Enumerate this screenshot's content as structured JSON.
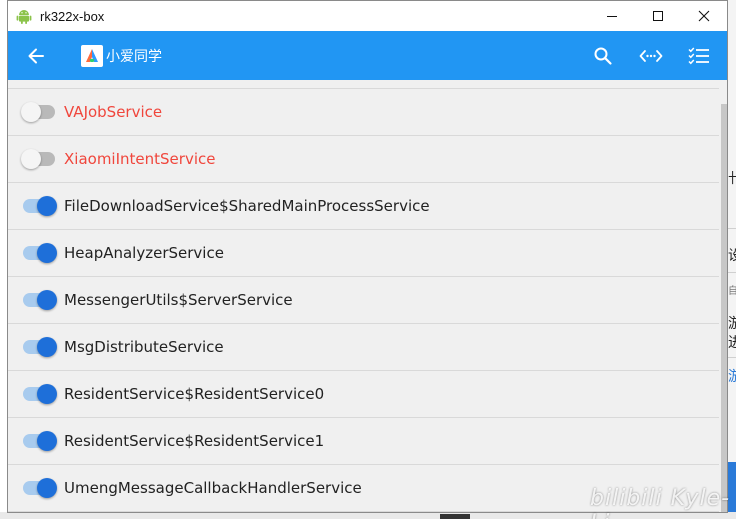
{
  "window": {
    "title": "rk322x-box",
    "controls": [
      {
        "name": "minimize-button",
        "icon": "minimize-icon"
      },
      {
        "name": "maximize-button",
        "icon": "maximize-icon"
      },
      {
        "name": "close-button",
        "icon": "close-icon"
      }
    ]
  },
  "appbar": {
    "back_icon": "arrow-left-icon",
    "app_name": "小爱同学",
    "actions": [
      {
        "name": "search-button",
        "icon": "search-icon"
      },
      {
        "name": "code-button",
        "icon": "code-icon"
      },
      {
        "name": "checklist-button",
        "icon": "checklist-icon"
      }
    ],
    "color": "#2196f3"
  },
  "services": [
    {
      "name": "VAJobService",
      "enabled": false
    },
    {
      "name": "XiaomiIntentService",
      "enabled": false
    },
    {
      "name": "FileDownloadService$SharedMainProcessService",
      "enabled": true
    },
    {
      "name": "HeapAnalyzerService",
      "enabled": true
    },
    {
      "name": "MessengerUtils$ServerService",
      "enabled": true
    },
    {
      "name": "MsgDistributeService",
      "enabled": true
    },
    {
      "name": "ResidentService$ResidentService0",
      "enabled": true
    },
    {
      "name": "ResidentService$ResidentService1",
      "enabled": true
    },
    {
      "name": "UmengMessageCallbackHandlerService",
      "enabled": true
    }
  ],
  "colors": {
    "disabled_text": "#f0463c",
    "switch_on": "#1e6fd9",
    "switch_on_track": "#a8cbee",
    "switch_off_track": "#b9b9b9"
  },
  "background": {
    "glyphs": [
      "卄",
      "设",
      "自",
      "游",
      "进",
      "游"
    ],
    "watermark": "bilibili Kyle-Li"
  }
}
